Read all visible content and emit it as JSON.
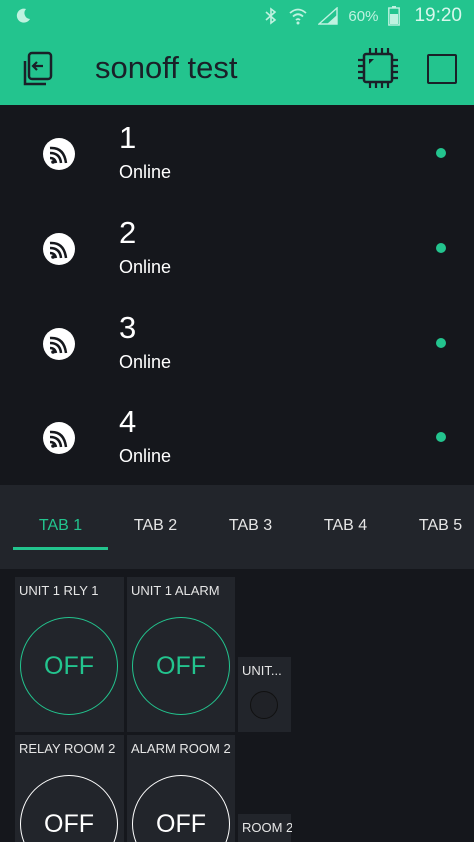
{
  "statusbar": {
    "battery_percent": "60%",
    "time": "19:20",
    "icons": [
      "moon-icon",
      "bluetooth-icon",
      "wifi-icon",
      "signal-icon",
      "battery-icon"
    ]
  },
  "appbar": {
    "title": "sonoff test",
    "icons": [
      "back-icon",
      "device-chip-icon",
      "square-icon"
    ],
    "accent_color": "#23c48e"
  },
  "devices": [
    {
      "name": "1",
      "status": "Online"
    },
    {
      "name": "2",
      "status": "Online"
    },
    {
      "name": "3",
      "status": "Online"
    },
    {
      "name": "4",
      "status": "Online"
    }
  ],
  "tabs": [
    {
      "label": "TAB 1",
      "active": true
    },
    {
      "label": "TAB 2",
      "active": false
    },
    {
      "label": "TAB 3",
      "active": false
    },
    {
      "label": "TAB 4",
      "active": false
    },
    {
      "label": "TAB 5",
      "active": false
    }
  ],
  "widgets": [
    {
      "label": "UNIT 1 RLY 1",
      "value": "OFF",
      "type": "button"
    },
    {
      "label": "UNIT 1 ALARM",
      "value": "OFF",
      "type": "button"
    },
    {
      "label": "UNIT...",
      "type": "led"
    },
    {
      "label": "RELAY ROOM 2",
      "value": "OFF",
      "type": "button"
    },
    {
      "label": "ALARM ROOM 2",
      "value": "OFF",
      "type": "button"
    },
    {
      "label": "ROOM 2",
      "type": "led"
    }
  ]
}
